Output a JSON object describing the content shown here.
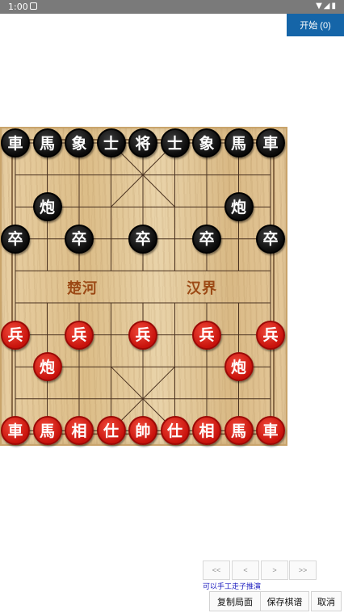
{
  "status_bar": {
    "time": "1:00",
    "icons": "▼◢▮"
  },
  "start_button": {
    "label": "开始 (0)"
  },
  "board": {
    "river_left": "楚河",
    "river_right": "汉界",
    "black_pieces": [
      {
        "ch": "車",
        "col": 0,
        "row": 0
      },
      {
        "ch": "馬",
        "col": 1,
        "row": 0
      },
      {
        "ch": "象",
        "col": 2,
        "row": 0
      },
      {
        "ch": "士",
        "col": 3,
        "row": 0
      },
      {
        "ch": "将",
        "col": 4,
        "row": 0
      },
      {
        "ch": "士",
        "col": 5,
        "row": 0
      },
      {
        "ch": "象",
        "col": 6,
        "row": 0
      },
      {
        "ch": "馬",
        "col": 7,
        "row": 0
      },
      {
        "ch": "車",
        "col": 8,
        "row": 0
      },
      {
        "ch": "炮",
        "col": 1,
        "row": 2
      },
      {
        "ch": "炮",
        "col": 7,
        "row": 2
      },
      {
        "ch": "卒",
        "col": 0,
        "row": 3
      },
      {
        "ch": "卒",
        "col": 2,
        "row": 3
      },
      {
        "ch": "卒",
        "col": 4,
        "row": 3
      },
      {
        "ch": "卒",
        "col": 6,
        "row": 3
      },
      {
        "ch": "卒",
        "col": 8,
        "row": 3
      }
    ],
    "red_pieces": [
      {
        "ch": "兵",
        "col": 0,
        "row": 6
      },
      {
        "ch": "兵",
        "col": 2,
        "row": 6
      },
      {
        "ch": "兵",
        "col": 4,
        "row": 6
      },
      {
        "ch": "兵",
        "col": 6,
        "row": 6
      },
      {
        "ch": "兵",
        "col": 8,
        "row": 6
      },
      {
        "ch": "炮",
        "col": 1,
        "row": 7
      },
      {
        "ch": "炮",
        "col": 7,
        "row": 7
      },
      {
        "ch": "車",
        "col": 0,
        "row": 9
      },
      {
        "ch": "馬",
        "col": 1,
        "row": 9
      },
      {
        "ch": "相",
        "col": 2,
        "row": 9
      },
      {
        "ch": "仕",
        "col": 3,
        "row": 9
      },
      {
        "ch": "帥",
        "col": 4,
        "row": 9
      },
      {
        "ch": "仕",
        "col": 5,
        "row": 9
      },
      {
        "ch": "相",
        "col": 6,
        "row": 9
      },
      {
        "ch": "馬",
        "col": 7,
        "row": 9
      },
      {
        "ch": "車",
        "col": 8,
        "row": 9
      }
    ]
  },
  "nav": {
    "first": "<<",
    "prev": "<",
    "next": ">",
    "last": ">>"
  },
  "hint": "可以手工走子推演",
  "actions": {
    "copy": "复制局面",
    "save": "保存棋谱",
    "cancel": "取消"
  }
}
